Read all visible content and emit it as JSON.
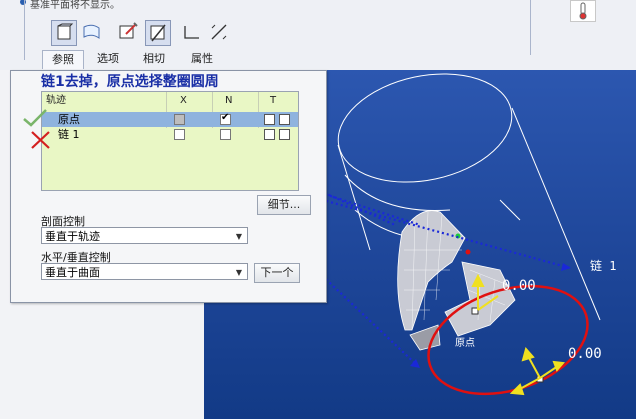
{
  "toolbar": {
    "hint_text": "基准平面将不显示。",
    "tabs": [
      "参照",
      "选项",
      "相切",
      "属性"
    ]
  },
  "panel": {
    "annotation": "链1去掉，原点选择整圈圆周",
    "grid": {
      "col_headers": [
        "轨迹",
        "X",
        "N",
        "T"
      ],
      "rows": [
        {
          "label": "原点",
          "x_checked": true,
          "n_checked": true
        },
        {
          "label": "链 1",
          "x_checked": false,
          "n_checked": false
        }
      ]
    },
    "detail_button": "细节...",
    "section_control_label": "剖面控制",
    "section_control_value": "垂直于轨迹",
    "hv_control_label": "水平/垂直控制",
    "hv_control_value": "垂直于曲面",
    "next_button": "下一个"
  },
  "viewport": {
    "chain_label": "链 1",
    "dim_1": "0.00",
    "dim_2": "0.00",
    "origin_label": "原点"
  },
  "colors": {
    "annotation_text": "#1a2fa6",
    "selected_row": "#8fb3de",
    "grid_bg": "#e9f7c5",
    "viewport_bg": "#1e4699",
    "trajectory_red": "#e01010",
    "arrow_yellow": "#f0e020"
  }
}
